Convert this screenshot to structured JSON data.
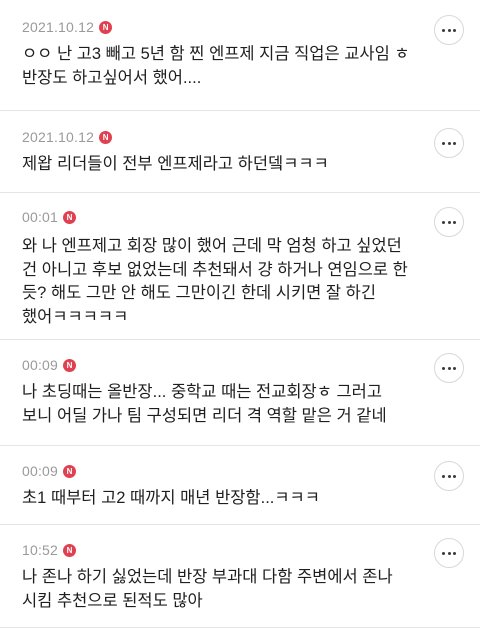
{
  "comments": [
    {
      "time": "2021.10.12",
      "badge": "N",
      "text": "ㅇㅇ 난 고3 빼고 5년 함 찐 엔프제 지금 직업은 교사임 ㅎ 반장도 하고싶어서 했어...."
    },
    {
      "time": "2021.10.12",
      "badge": "N",
      "text": "제왑 리더들이 전부 엔프제라고 하던뎈ㅋㅋㅋ"
    },
    {
      "time": "00:01",
      "badge": "N",
      "text": "와 나 엔프제고 회장 많이 했어 근데 막 엄청 하고 싶었던 건 아니고 후보 없었는데 추천돼서 걍 하거나 연임으로 한 듯? 해도 그만 안 해도 그만이긴 한데 시키면 잘 하긴 했어ㅋㅋㅋㅋㅋ"
    },
    {
      "time": "00:09",
      "badge": "N",
      "text": "나 초딩때는 올반장... 중학교 때는 전교회장ㅎ 그러고 보니 어딜 가나 팀 구성되면 리더 격 역할 맡은 거 같네"
    },
    {
      "time": "00:09",
      "badge": "N",
      "text": "초1 때부터 고2 때까지 매년 반장함...ㅋㅋㅋ"
    },
    {
      "time": "10:52",
      "badge": "N",
      "text": "나 존나 하기 싫었는데 반장 부과대 다함 주변에서 존나 시킴 추천으로 된적도 많아"
    }
  ],
  "more_icon": "more-horizontal-icon"
}
